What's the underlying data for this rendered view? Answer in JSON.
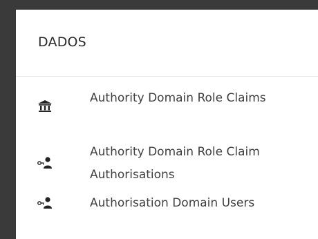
{
  "panel": {
    "title": "DADOS"
  },
  "menu": {
    "items": [
      {
        "label": "Authority Domain Role Claims",
        "icon": "bank-icon"
      },
      {
        "label": "Authority Domain Role Claim Authorisations",
        "icon": "user-key-icon"
      },
      {
        "label": "Authorisation Domain Users",
        "icon": "user-key-icon"
      }
    ]
  },
  "colors": {
    "background": "#3a3a3a",
    "panel": "#ffffff",
    "text": "#404040",
    "divider": "#e6e6e6"
  }
}
